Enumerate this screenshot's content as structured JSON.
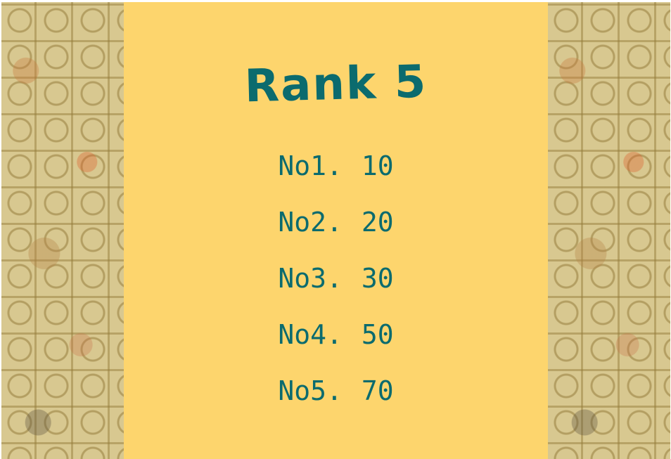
{
  "title": "Rank 5",
  "rankings": [
    {
      "label": "No1.",
      "score": "10"
    },
    {
      "label": "No2.",
      "score": "20"
    },
    {
      "label": "No3.",
      "score": "30"
    },
    {
      "label": "No4.",
      "score": "50"
    },
    {
      "label": "No5.",
      "score": "70"
    }
  ],
  "colors": {
    "panel_background": "#fdd56d",
    "text": "#0b6b6e",
    "side_background": "#d8c890"
  }
}
